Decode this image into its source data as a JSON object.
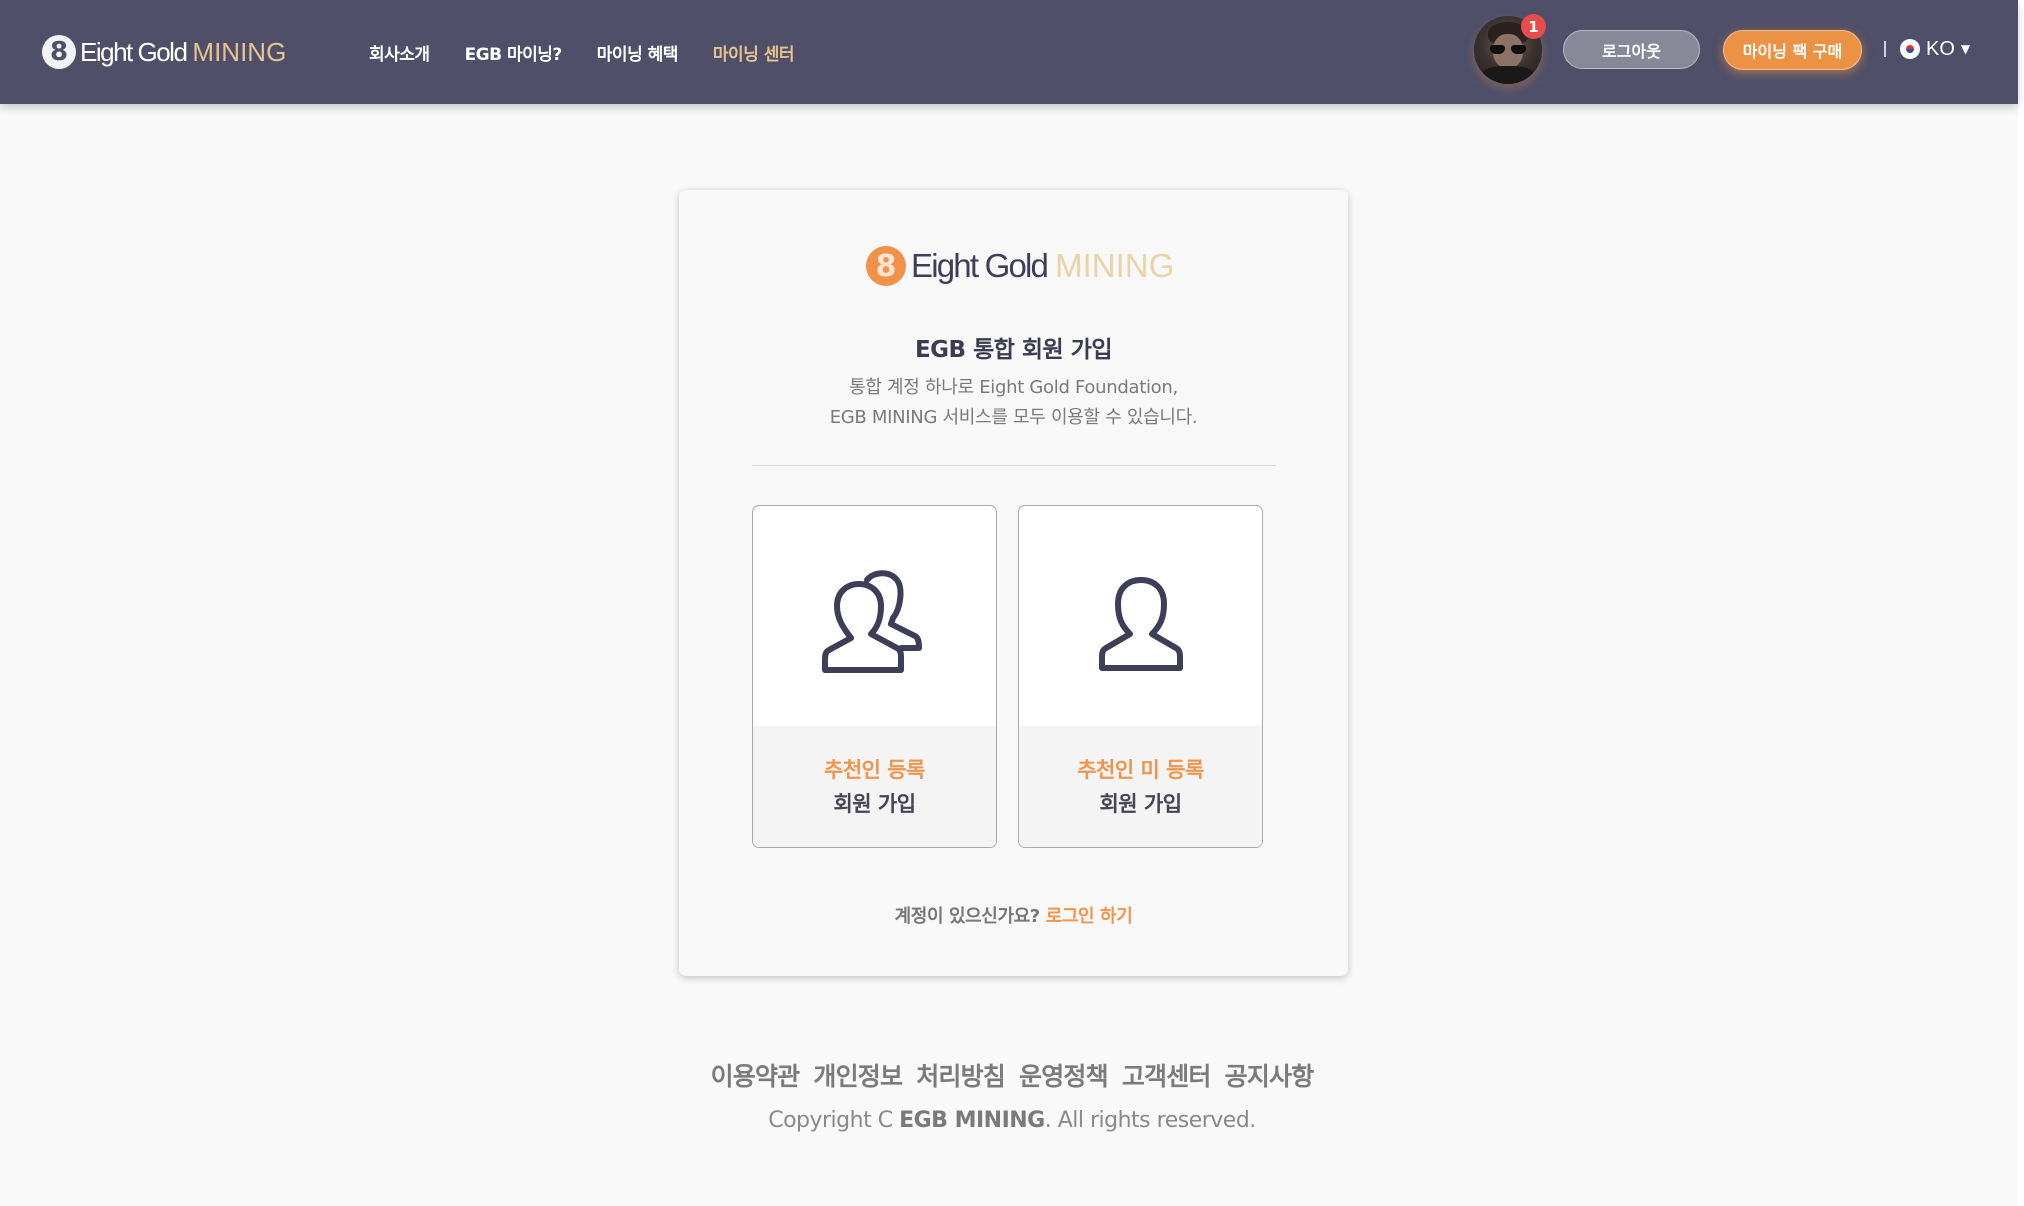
{
  "header": {
    "logo": {
      "mark": "8",
      "brand": "Eight Gold",
      "brand_accent": "MINING"
    },
    "nav": [
      {
        "label": "회사소개",
        "active": false
      },
      {
        "label": "EGB 마이닝?",
        "active": false
      },
      {
        "label": "마이닝 혜택",
        "active": false
      },
      {
        "label": "마이닝 센터",
        "active": true
      }
    ],
    "notification_count": "1",
    "logout_label": "로그아웃",
    "buy_label": "마이닝 팩 구매",
    "language": {
      "label": "KO",
      "flag": "korea-flag-icon"
    }
  },
  "card": {
    "logo": {
      "mark": "8",
      "brand": "Eight Gold",
      "brand_accent": "MINING"
    },
    "title": "EGB 통합 회원 가입",
    "subtitle_line1": "통합 계정 하나로 Eight Gold Foundation,",
    "subtitle_line2": "EGB MINING 서비스를 모두 이용할 수 있습니다.",
    "options": [
      {
        "icon": "users-icon",
        "line1": "추천인 등록",
        "line2": "회원 가입"
      },
      {
        "icon": "user-icon",
        "line1": "추천인 미 등록",
        "line2": "회원 가입"
      }
    ],
    "login_prompt": "계정이 있으신가요?",
    "login_link": "로그인 하기"
  },
  "footer": {
    "links": [
      "이용약관",
      "개인정보",
      "처리방침",
      "운영정책",
      "고객센터",
      "공지사항"
    ],
    "copyright_prefix": "Copyright C ",
    "copyright_brand": "EGB MINING",
    "copyright_suffix": ". All rights reserved."
  },
  "colors": {
    "header_bg": "#4f4f69",
    "accent_orange": "#f0954d",
    "accent_gold": "#e5c48f",
    "icon_stroke": "#3e3e58"
  }
}
